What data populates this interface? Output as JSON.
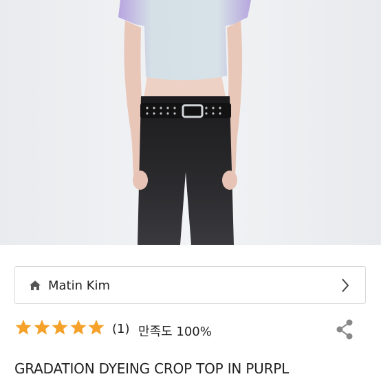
{
  "shop": {
    "name": "Matin Kim",
    "home_icon": "home-icon",
    "chevron_icon": "chevron-right-icon"
  },
  "rating": {
    "stars": 5,
    "max_stars": 5,
    "review_count": "(1)",
    "satisfaction": "만족도 100%",
    "star_color": "#f5a12a",
    "star_icon": "star-icon"
  },
  "share": {
    "icon": "share-icon"
  },
  "product": {
    "title": "GRADATION DYEING CROP TOP IN PURPL"
  }
}
